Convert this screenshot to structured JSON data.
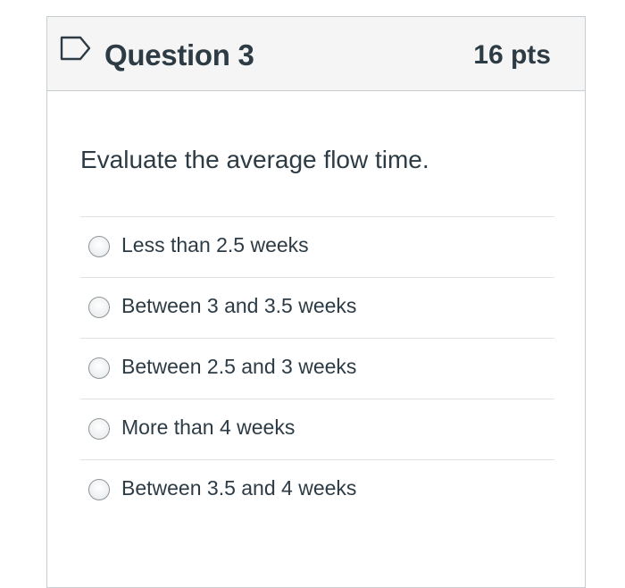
{
  "question": {
    "title": "Question 3",
    "points": "16 pts",
    "flag_icon": "flag-outline-icon",
    "text": "Evaluate the average flow time."
  },
  "answers": [
    {
      "label": "Less than 2.5 weeks",
      "selected": false
    },
    {
      "label": "Between 3 and 3.5 weeks",
      "selected": false
    },
    {
      "label": "Between 2.5 and 3 weeks",
      "selected": false
    },
    {
      "label": "More than 4 weeks",
      "selected": false
    },
    {
      "label": "Between 3.5 and 4 weeks",
      "selected": false
    }
  ],
  "colors": {
    "header_bg": "#f5f5f5",
    "border": "#c7cdd1",
    "text": "#2d3b45",
    "flag": "#2d3b45"
  }
}
